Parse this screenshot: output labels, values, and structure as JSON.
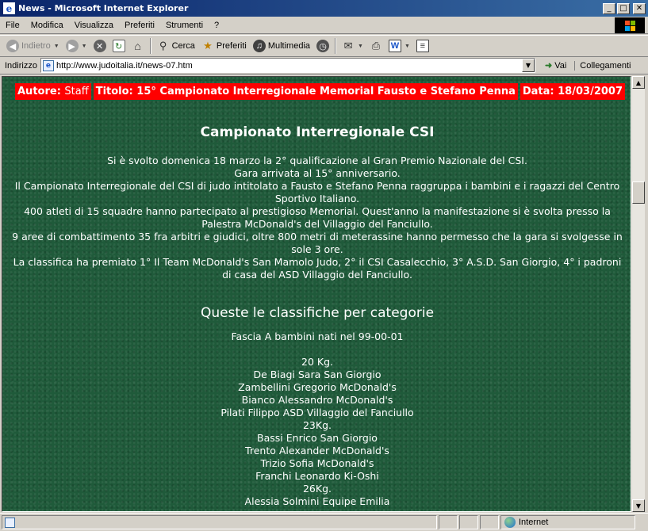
{
  "window": {
    "title": "News - Microsoft Internet Explorer",
    "app_icon": "e",
    "buttons": {
      "minimize": "_",
      "maximize": "□",
      "close": "✕"
    }
  },
  "menu": [
    "File",
    "Modifica",
    "Visualizza",
    "Preferiti",
    "Strumenti",
    "?"
  ],
  "toolbar": {
    "back": "Indietro",
    "search": "Cerca",
    "favorites": "Preferiti",
    "multimedia": "Multimedia"
  },
  "address": {
    "label": "Indirizzo",
    "url": "http://www.judoitalia.it/news-07.htm",
    "go": "Vai",
    "links": "Collegamenti"
  },
  "article": {
    "author_label": "Autore:",
    "author": "Staff",
    "title_label": "Titolo:",
    "title": "15° Campionato Interregionale Memorial Fausto e Stefano Penna",
    "date_label": "Data:",
    "date": "18/03/2007",
    "heading": "Campionato Interregionale CSI",
    "body": [
      "Si è svolto domenica 18 marzo la 2° qualificazione al Gran Premio Nazionale del CSI.",
      "Gara arrivata al 15° anniversario.",
      "Il Campionato Interregionale del CSI di judo intitolato a Fausto e Stefano Penna raggruppa i bambini e i ragazzi del Centro Sportivo Italiano.",
      "400 atleti di 15 squadre hanno partecipato al prestigioso Memorial. Quest'anno la manifestazione si è svolta presso la Palestra McDonald's del Villaggio del Fanciullo.",
      "9 aree di combattimento 35 fra arbitri e giudici, oltre 800 metri di meterassine hanno permesso che la gara si svolgesse in sole 3 ore.",
      "La classifica ha premiato 1° Il Team McDonald's San Mamolo Judo, 2° il CSI Casalecchio, 3° A.S.D. San Giorgio, 4° i padroni di casa del ASD Villaggio del Fanciullo."
    ],
    "subheading": "Queste le classifiche per categorie",
    "category": "Fascia A bambini nati nel 99-00-01",
    "results": [
      "20 Kg.",
      "De Biagi Sara San Giorgio",
      "Zambellini Gregorio McDonald's",
      "Bianco Alessandro McDonald's",
      "Pilati Filippo ASD Villaggio del Fanciullo",
      "23Kg.",
      "Bassi Enrico San Giorgio",
      "Trento Alexander McDonald's",
      "Trizio Sofia McDonald's",
      "Franchi Leonardo Ki-Oshi",
      "26Kg.",
      "Alessia Solmini Equipe Emilia"
    ]
  },
  "status": {
    "zone": "Internet"
  },
  "colors": {
    "header_bg": "#ff0000",
    "page_bg": "#1f5a3a",
    "titlebar": "#0a246a"
  }
}
